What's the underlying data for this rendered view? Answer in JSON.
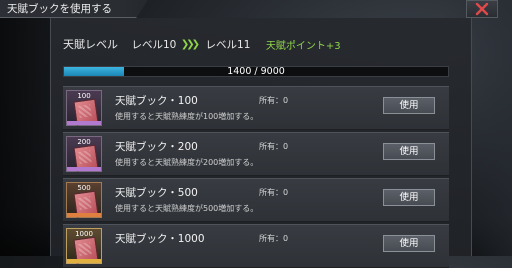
{
  "window": {
    "title": "天賦ブックを使用する"
  },
  "talent": {
    "label": "天賦レベル",
    "from": "レベル10",
    "arrows": "❯❯❯",
    "to": "レベル11",
    "points": "天賦ポイント+3"
  },
  "progress": {
    "text": "1400 / 9000",
    "fraction": 0.1556
  },
  "colors": {
    "accent_green": "#8fd54a",
    "progress_blue": "#2aa0d0"
  },
  "items": [
    {
      "qty": "100",
      "name": "天賦ブック・100",
      "owned": "所有：0",
      "desc": "使用すると天賦熟練度が100増加する。",
      "button": "使用"
    },
    {
      "qty": "200",
      "name": "天賦ブック・200",
      "owned": "所有：0",
      "desc": "使用すると天賦熟練度が200増加する。",
      "button": "使用"
    },
    {
      "qty": "500",
      "name": "天賦ブック・500",
      "owned": "所有：0",
      "desc": "使用すると天賦熟練度が500増加する。",
      "button": "使用"
    },
    {
      "qty": "1000",
      "name": "天賦ブック・1000",
      "owned": "所有：0",
      "desc": "",
      "button": "使用"
    }
  ]
}
